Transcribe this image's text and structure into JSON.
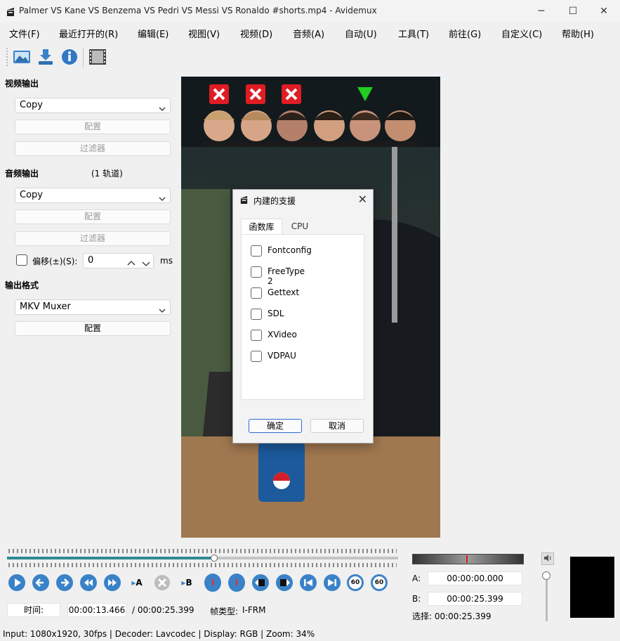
{
  "window": {
    "title": "Palmer VS Kane VS Benzema VS Pedri VS Messi VS Ronaldo #shorts.mp4 - Avidemux",
    "minimize_glyph": "─",
    "maximize_glyph": "☐",
    "close_glyph": "✕"
  },
  "menu": [
    "文件(F)",
    "最近打开的(R)",
    "编辑(E)",
    "视图(V)",
    "视频(D)",
    "音频(A)",
    "自动(U)",
    "工具(T)",
    "前往(G)",
    "自定义(C)",
    "帮助(H)"
  ],
  "toolbar": {
    "icons": [
      "open-video-icon",
      "save-video-icon",
      "properties-info-icon",
      "film-strip-icon"
    ]
  },
  "video_output": {
    "title": "视频输出",
    "codec": "Copy",
    "configure": "配置",
    "filters": "过滤器"
  },
  "audio_output": {
    "title": "音频输出",
    "tracks": "(1 轨道)",
    "codec": "Copy",
    "configure": "配置",
    "filters": "过滤器",
    "shift_label": "偏移(±)(S):",
    "shift_value": "0",
    "shift_unit": "ms"
  },
  "output_format": {
    "title": "输出格式",
    "muxer": "MKV Muxer",
    "configure": "配置"
  },
  "dialog": {
    "title": "内建的支援",
    "close_glyph": "✕",
    "tabs": [
      "函数库",
      "CPU"
    ],
    "libraries": [
      "Fontconfig",
      "FreeType 2",
      "Gettext",
      "SDL",
      "XVideo",
      "VDPAU"
    ],
    "ok": "确定",
    "cancel": "取消"
  },
  "timeline": {
    "position": 0.5297
  },
  "time": {
    "label": "时间:",
    "current": "00:00:13.466",
    "total": "/ 00:00:25.399",
    "frame_type_label": "帧类型:",
    "frame_type": "I-FRM"
  },
  "markers": {
    "a_label": "A:",
    "a_value": "00:00:00.000",
    "b_label": "B:",
    "b_value": "00:00:25.399",
    "selection": "选择: 00:00:25.399"
  },
  "playback_buttons": {
    "a_marker_text": "A",
    "b_marker_text": "B",
    "i_text": "I",
    "sixty_text": "60"
  },
  "status": "Input: 1080x1920, 30fps  |  Decoder: Lavcodec  |  Display: RGB  |  Zoom: 34%",
  "colors": {
    "accent": "#3a82c8",
    "timeline_progress": "#2e8b95",
    "mark_red": "#e01c24",
    "mark_green": "#22cc22"
  }
}
